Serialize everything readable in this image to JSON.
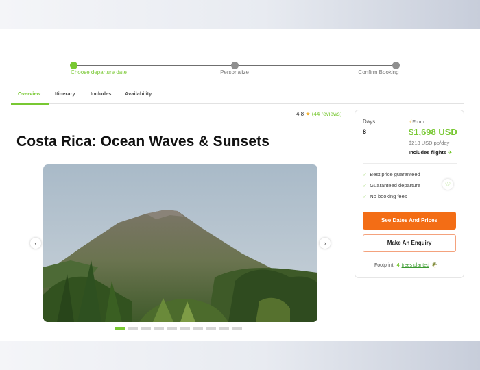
{
  "stepper": {
    "steps": [
      {
        "label": "Choose departure date",
        "active": true
      },
      {
        "label": "Personalize",
        "active": false
      },
      {
        "label": "Confirm Booking",
        "active": false
      }
    ]
  },
  "tabs": [
    {
      "label": "Overview",
      "active": true
    },
    {
      "label": "Itinerary",
      "active": false
    },
    {
      "label": "Includes",
      "active": false
    },
    {
      "label": "Availability",
      "active": false
    }
  ],
  "rating": {
    "score": "4.8",
    "star": "★",
    "reviews": "44 reviews"
  },
  "title": "Costa Rica: Ocean Waves & Sunsets",
  "carousel": {
    "prev": "‹",
    "next": "›",
    "slide_count": 10,
    "active_slide": 1
  },
  "booking": {
    "days_label": "Days",
    "days_value": "8",
    "from_label": "From",
    "price": "$1,698 USD",
    "per_day": "$213 USD pp/day",
    "flights": "Includes flights",
    "features": [
      "Best price guaranteed",
      "Guaranteed departure",
      "No booking fees"
    ],
    "primary_button": "See Dates And Prices",
    "secondary_button": "Make An Enquiry",
    "footprint_label": "Footprint:",
    "trees_count": "4",
    "trees_link": "trees planted"
  },
  "colors": {
    "accent": "#78c832",
    "cta": "#f36d15"
  }
}
